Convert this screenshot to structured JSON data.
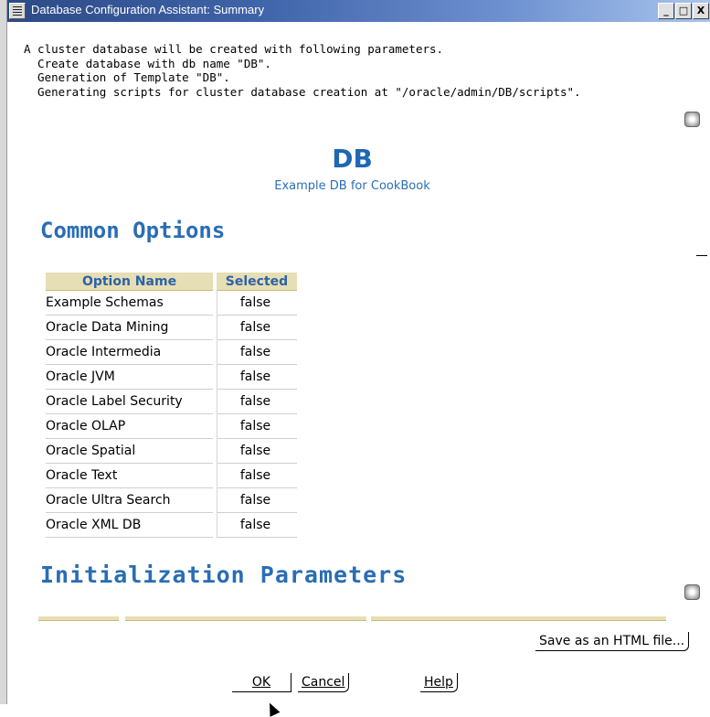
{
  "window": {
    "title": "Database Configuration Assistant: Summary",
    "buttons": {
      "minimize": "_",
      "maximize": "□",
      "close": "X"
    }
  },
  "summary": {
    "intro_lines": [
      "A cluster database will be created with following parameters.",
      "  Create database with db name \"DB\".",
      "  Generation of Template \"DB\".",
      "  Generating scripts for cluster database creation at \"/oracle/admin/DB/scripts\"."
    ],
    "db_name": "DB",
    "db_description": "Example DB for CookBook"
  },
  "common_options": {
    "heading": "Common Options",
    "columns": [
      "Option Name",
      "Selected"
    ],
    "rows": [
      [
        "Example Schemas",
        "false"
      ],
      [
        "Oracle Data Mining",
        "false"
      ],
      [
        "Oracle Intermedia",
        "false"
      ],
      [
        "Oracle JVM",
        "false"
      ],
      [
        "Oracle Label Security",
        "false"
      ],
      [
        "Oracle OLAP",
        "false"
      ],
      [
        "Oracle Spatial",
        "false"
      ],
      [
        "Oracle Text",
        "false"
      ],
      [
        "Oracle Ultra Search",
        "false"
      ],
      [
        "Oracle XML DB",
        "false"
      ]
    ]
  },
  "init_params": {
    "heading": "Initialization Parameters"
  },
  "actions": {
    "save_html": "Save as an HTML file...",
    "ok": "OK",
    "cancel": "Cancel",
    "help": "Help"
  },
  "colors": {
    "title_bar": "#2c4a86",
    "heading": "#2a6db4",
    "table_header_bg": "#e6deb4"
  }
}
